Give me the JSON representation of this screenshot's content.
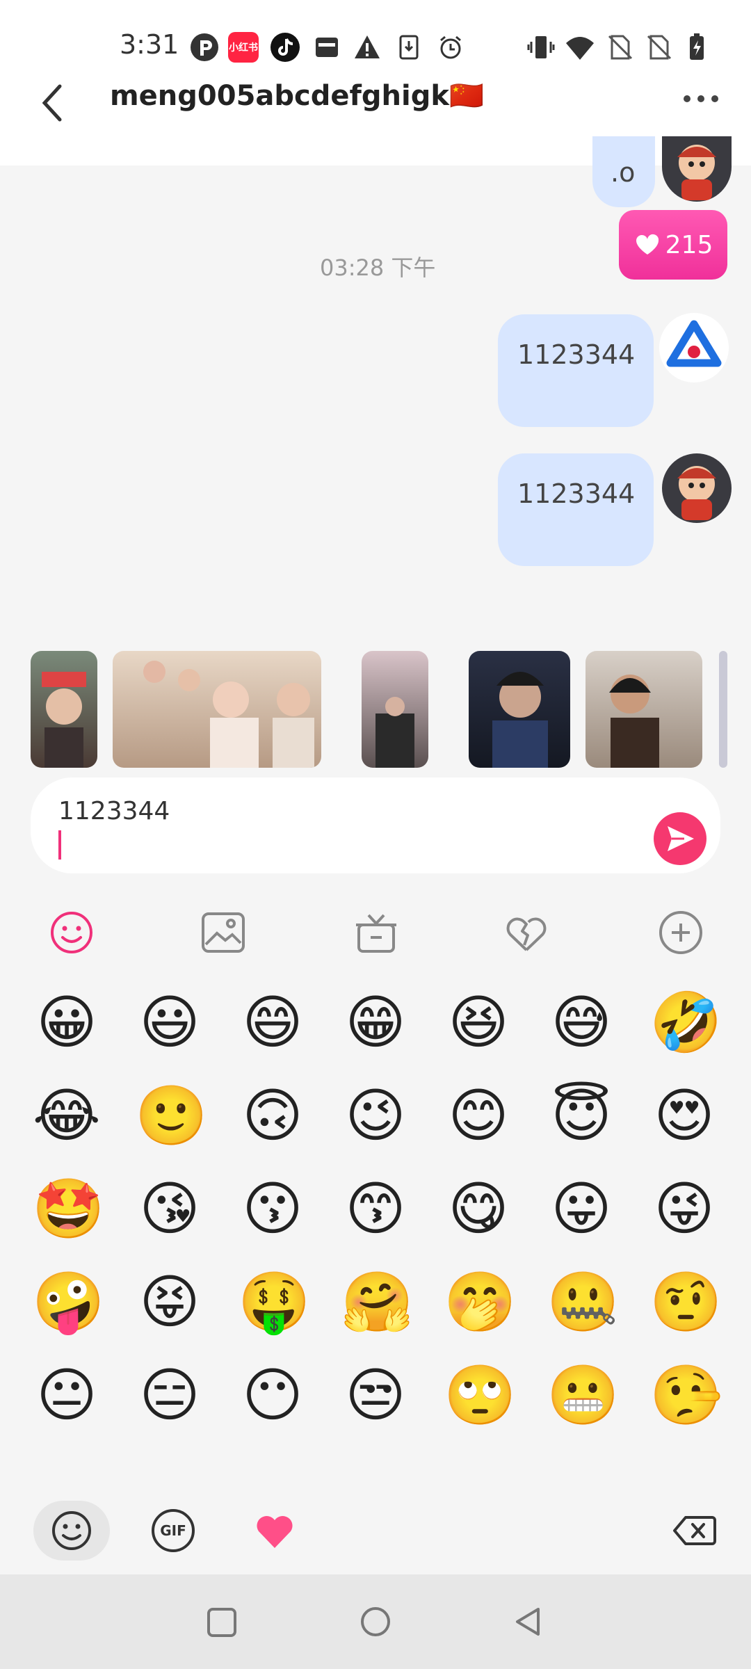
{
  "status_bar": {
    "time": "3:31",
    "badge_xiaohongshu": "小红书",
    "icons": [
      "p-app-icon",
      "xiaohongshu-icon",
      "tiktok-icon",
      "wallet-icon",
      "warning-icon",
      "download-icon",
      "alarm-icon",
      "vibrate-icon",
      "wifi-icon",
      "no-sim-icon",
      "no-sim-icon",
      "battery-charging-icon"
    ]
  },
  "header": {
    "title": "meng005abcdefghigk🇨🇳"
  },
  "messages": [
    {
      "text": ".o",
      "side": "right",
      "avatar": "cartoon-avatar"
    },
    {
      "text": "215",
      "type": "like",
      "icon": "heart-icon"
    },
    {
      "text": "1123344",
      "side": "right",
      "avatar": "app-logo-avatar"
    },
    {
      "text": "1123344",
      "side": "right",
      "avatar": "cartoon-avatar"
    }
  ],
  "timestamp": "03:28 下午",
  "photos": [
    "photo-1",
    "photo-2",
    "photo-3",
    "photo-4",
    "photo-5",
    "photo-6"
  ],
  "input": {
    "value": "1123344"
  },
  "toolbar": [
    "emoji-icon",
    "image-icon",
    "gift-icon",
    "heart-broken-icon",
    "plus-icon"
  ],
  "emojis": [
    [
      "😀",
      "😃",
      "😄",
      "😁",
      "😆",
      "😅",
      "🤣"
    ],
    [
      "😂",
      "🙂",
      "🙃",
      "😉",
      "😊",
      "😇",
      "😍"
    ],
    [
      "🤩",
      "😘",
      "😗",
      "😙",
      "😋",
      "😛",
      "😜"
    ],
    [
      "🤪",
      "😝",
      "🤑",
      "🤗",
      "🤭",
      "🤐",
      "🤨"
    ],
    [
      "😐",
      "😑",
      "😶",
      "😒",
      "🙄",
      "😬",
      "🤥"
    ]
  ],
  "bottom_bar": {
    "gif_label": "GIF",
    "tabs": [
      "emoji-tab",
      "gif-tab",
      "heart-tab"
    ],
    "backspace": "backspace-icon"
  },
  "colors": {
    "accent_pink": "#f0307a",
    "bubble_blue": "#d8e6ff"
  }
}
